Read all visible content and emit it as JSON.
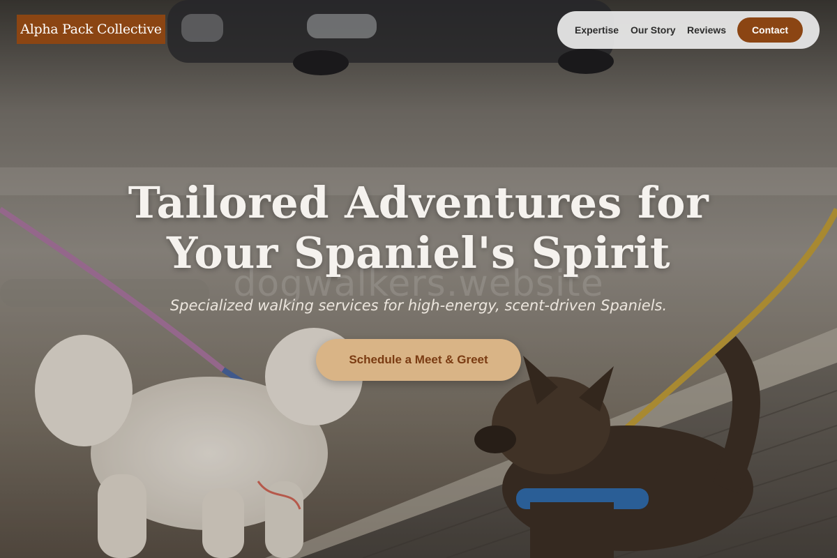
{
  "brand": {
    "logo_text": "Alpha Pack Collective",
    "color": "#8b4513"
  },
  "nav": {
    "items": [
      {
        "label": "Expertise"
      },
      {
        "label": "Our Story"
      },
      {
        "label": "Reviews"
      }
    ],
    "contact_label": "Contact"
  },
  "hero": {
    "headline_line1": "Tailored Adventures for",
    "headline_line2": "Your Spaniel's Spirit",
    "subheadline": "Specialized walking services for high-energy, scent-driven Spaniels.",
    "cta_label": "Schedule a Meet & Greet",
    "cta_color": "#d9b486",
    "watermark": "dogwalkers.website",
    "image_description": "two dogs on leashes on a city sidewalk"
  }
}
